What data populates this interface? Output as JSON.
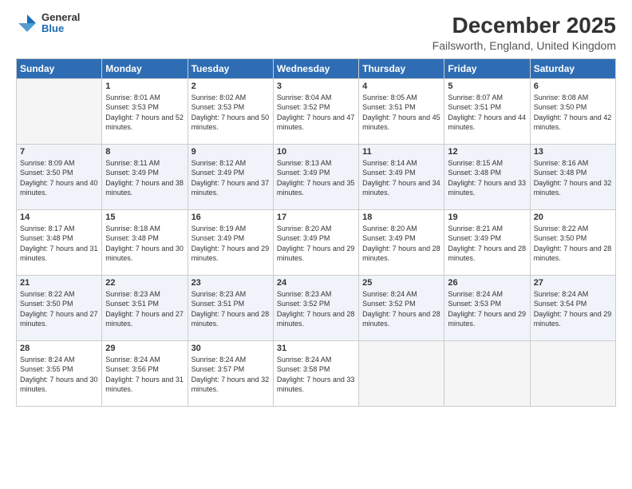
{
  "logo": {
    "general": "General",
    "blue": "Blue"
  },
  "title": "December 2025",
  "subtitle": "Failsworth, England, United Kingdom",
  "headers": [
    "Sunday",
    "Monday",
    "Tuesday",
    "Wednesday",
    "Thursday",
    "Friday",
    "Saturday"
  ],
  "weeks": [
    [
      {
        "day": "",
        "sunrise": "",
        "sunset": "",
        "daylight": "",
        "empty": true
      },
      {
        "day": "1",
        "sunrise": "Sunrise: 8:01 AM",
        "sunset": "Sunset: 3:53 PM",
        "daylight": "Daylight: 7 hours and 52 minutes."
      },
      {
        "day": "2",
        "sunrise": "Sunrise: 8:02 AM",
        "sunset": "Sunset: 3:53 PM",
        "daylight": "Daylight: 7 hours and 50 minutes."
      },
      {
        "day": "3",
        "sunrise": "Sunrise: 8:04 AM",
        "sunset": "Sunset: 3:52 PM",
        "daylight": "Daylight: 7 hours and 47 minutes."
      },
      {
        "day": "4",
        "sunrise": "Sunrise: 8:05 AM",
        "sunset": "Sunset: 3:51 PM",
        "daylight": "Daylight: 7 hours and 45 minutes."
      },
      {
        "day": "5",
        "sunrise": "Sunrise: 8:07 AM",
        "sunset": "Sunset: 3:51 PM",
        "daylight": "Daylight: 7 hours and 44 minutes."
      },
      {
        "day": "6",
        "sunrise": "Sunrise: 8:08 AM",
        "sunset": "Sunset: 3:50 PM",
        "daylight": "Daylight: 7 hours and 42 minutes."
      }
    ],
    [
      {
        "day": "7",
        "sunrise": "Sunrise: 8:09 AM",
        "sunset": "Sunset: 3:50 PM",
        "daylight": "Daylight: 7 hours and 40 minutes."
      },
      {
        "day": "8",
        "sunrise": "Sunrise: 8:11 AM",
        "sunset": "Sunset: 3:49 PM",
        "daylight": "Daylight: 7 hours and 38 minutes."
      },
      {
        "day": "9",
        "sunrise": "Sunrise: 8:12 AM",
        "sunset": "Sunset: 3:49 PM",
        "daylight": "Daylight: 7 hours and 37 minutes."
      },
      {
        "day": "10",
        "sunrise": "Sunrise: 8:13 AM",
        "sunset": "Sunset: 3:49 PM",
        "daylight": "Daylight: 7 hours and 35 minutes."
      },
      {
        "day": "11",
        "sunrise": "Sunrise: 8:14 AM",
        "sunset": "Sunset: 3:49 PM",
        "daylight": "Daylight: 7 hours and 34 minutes."
      },
      {
        "day": "12",
        "sunrise": "Sunrise: 8:15 AM",
        "sunset": "Sunset: 3:48 PM",
        "daylight": "Daylight: 7 hours and 33 minutes."
      },
      {
        "day": "13",
        "sunrise": "Sunrise: 8:16 AM",
        "sunset": "Sunset: 3:48 PM",
        "daylight": "Daylight: 7 hours and 32 minutes."
      }
    ],
    [
      {
        "day": "14",
        "sunrise": "Sunrise: 8:17 AM",
        "sunset": "Sunset: 3:48 PM",
        "daylight": "Daylight: 7 hours and 31 minutes."
      },
      {
        "day": "15",
        "sunrise": "Sunrise: 8:18 AM",
        "sunset": "Sunset: 3:48 PM",
        "daylight": "Daylight: 7 hours and 30 minutes."
      },
      {
        "day": "16",
        "sunrise": "Sunrise: 8:19 AM",
        "sunset": "Sunset: 3:49 PM",
        "daylight": "Daylight: 7 hours and 29 minutes."
      },
      {
        "day": "17",
        "sunrise": "Sunrise: 8:20 AM",
        "sunset": "Sunset: 3:49 PM",
        "daylight": "Daylight: 7 hours and 29 minutes."
      },
      {
        "day": "18",
        "sunrise": "Sunrise: 8:20 AM",
        "sunset": "Sunset: 3:49 PM",
        "daylight": "Daylight: 7 hours and 28 minutes."
      },
      {
        "day": "19",
        "sunrise": "Sunrise: 8:21 AM",
        "sunset": "Sunset: 3:49 PM",
        "daylight": "Daylight: 7 hours and 28 minutes."
      },
      {
        "day": "20",
        "sunrise": "Sunrise: 8:22 AM",
        "sunset": "Sunset: 3:50 PM",
        "daylight": "Daylight: 7 hours and 28 minutes."
      }
    ],
    [
      {
        "day": "21",
        "sunrise": "Sunrise: 8:22 AM",
        "sunset": "Sunset: 3:50 PM",
        "daylight": "Daylight: 7 hours and 27 minutes."
      },
      {
        "day": "22",
        "sunrise": "Sunrise: 8:23 AM",
        "sunset": "Sunset: 3:51 PM",
        "daylight": "Daylight: 7 hours and 27 minutes."
      },
      {
        "day": "23",
        "sunrise": "Sunrise: 8:23 AM",
        "sunset": "Sunset: 3:51 PM",
        "daylight": "Daylight: 7 hours and 28 minutes."
      },
      {
        "day": "24",
        "sunrise": "Sunrise: 8:23 AM",
        "sunset": "Sunset: 3:52 PM",
        "daylight": "Daylight: 7 hours and 28 minutes."
      },
      {
        "day": "25",
        "sunrise": "Sunrise: 8:24 AM",
        "sunset": "Sunset: 3:52 PM",
        "daylight": "Daylight: 7 hours and 28 minutes."
      },
      {
        "day": "26",
        "sunrise": "Sunrise: 8:24 AM",
        "sunset": "Sunset: 3:53 PM",
        "daylight": "Daylight: 7 hours and 29 minutes."
      },
      {
        "day": "27",
        "sunrise": "Sunrise: 8:24 AM",
        "sunset": "Sunset: 3:54 PM",
        "daylight": "Daylight: 7 hours and 29 minutes."
      }
    ],
    [
      {
        "day": "28",
        "sunrise": "Sunrise: 8:24 AM",
        "sunset": "Sunset: 3:55 PM",
        "daylight": "Daylight: 7 hours and 30 minutes."
      },
      {
        "day": "29",
        "sunrise": "Sunrise: 8:24 AM",
        "sunset": "Sunset: 3:56 PM",
        "daylight": "Daylight: 7 hours and 31 minutes."
      },
      {
        "day": "30",
        "sunrise": "Sunrise: 8:24 AM",
        "sunset": "Sunset: 3:57 PM",
        "daylight": "Daylight: 7 hours and 32 minutes."
      },
      {
        "day": "31",
        "sunrise": "Sunrise: 8:24 AM",
        "sunset": "Sunset: 3:58 PM",
        "daylight": "Daylight: 7 hours and 33 minutes."
      },
      {
        "day": "",
        "sunrise": "",
        "sunset": "",
        "daylight": "",
        "empty": true
      },
      {
        "day": "",
        "sunrise": "",
        "sunset": "",
        "daylight": "",
        "empty": true
      },
      {
        "day": "",
        "sunrise": "",
        "sunset": "",
        "daylight": "",
        "empty": true
      }
    ]
  ]
}
